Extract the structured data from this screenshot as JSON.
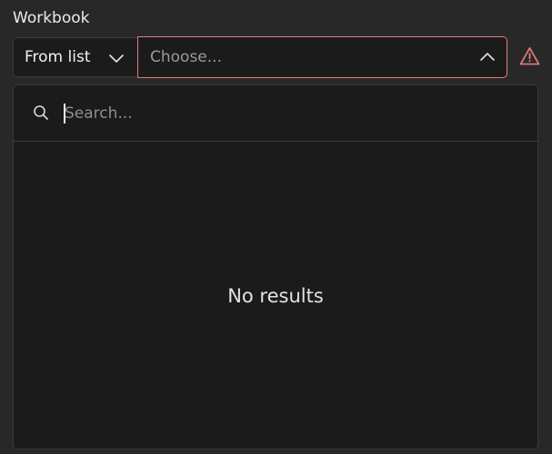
{
  "field": {
    "label": "Workbook"
  },
  "mode_select": {
    "selected": "From list",
    "icon": "chevron-down-icon"
  },
  "value_select": {
    "placeholder": "Choose...",
    "icon": "chevron-up-icon",
    "border_color": "#e07c7c"
  },
  "warning": {
    "icon": "warning-triangle-icon",
    "color": "#e07c7c"
  },
  "dropdown": {
    "search": {
      "placeholder": "Search...",
      "value": "",
      "icon": "search-icon"
    },
    "empty_message": "No results"
  }
}
